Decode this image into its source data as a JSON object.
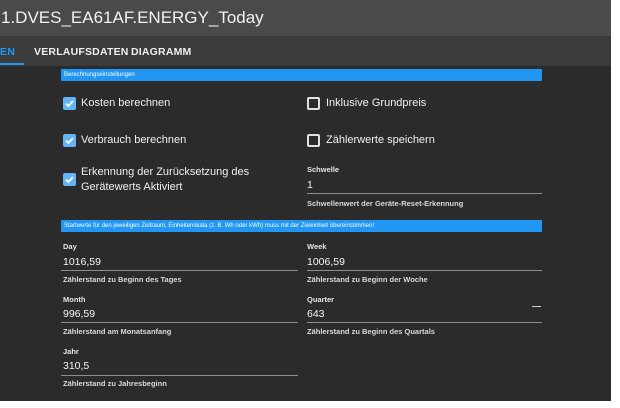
{
  "window": {
    "title": "1.DVES_EA61AF.ENERGY_Today"
  },
  "tabs": [
    {
      "label": "EN",
      "active": true
    },
    {
      "label": "VERLAUFSDATEN",
      "active": false
    },
    {
      "label": "DIAGRAMM",
      "active": false
    }
  ],
  "section_calc": {
    "title": "Berechnungseinstellungen"
  },
  "checkboxes": {
    "cost": {
      "label": "Kosten berechnen",
      "checked": true
    },
    "base_price": {
      "label": "Inklusive Grundpreis",
      "checked": false
    },
    "consumption": {
      "label": "Verbrauch berechnen",
      "checked": true
    },
    "save_meter": {
      "label": "Zählerwerte speichern",
      "checked": false
    },
    "reset_detect": {
      "line1": "Erkennung der Zurücksetzung des",
      "line2": "Gerätewerts Aktiviert",
      "checked": true
    }
  },
  "threshold": {
    "label": "Schwelle",
    "value": "1",
    "help": "Schwellenwert der Geräte-Reset-Erkennung"
  },
  "section_start": {
    "title": "Startwerte für den jeweiligen Zeitraum, Einheitenskala (z. B. Wh oder kWh) muss mit der Zieleinheit übereinstimmen!"
  },
  "fields": {
    "day": {
      "label": "Day",
      "value": "1016,59",
      "help": "Zählerstand zu Beginn des Tages"
    },
    "week": {
      "label": "Week",
      "value": "1006,59",
      "help": "Zählerstand zu Beginn der Woche"
    },
    "month": {
      "label": "Month",
      "value": "996,59",
      "help": "Zählerstand am Monatsanfang"
    },
    "quarter": {
      "label": "Quarter",
      "value": "643",
      "help": "Zählerstand zu Beginn des Quartals"
    },
    "year": {
      "label": "Jahr",
      "value": "310,5",
      "help": "Zählerstand zu Jahresbeginn"
    }
  },
  "colors": {
    "accent": "#2196f3",
    "checkbox": "#64b5f6",
    "background": "#2b2b2b",
    "titlebar": "#4a4a4a"
  },
  "icons": {
    "checked": "check-icon",
    "unchecked": "empty-box-icon"
  }
}
